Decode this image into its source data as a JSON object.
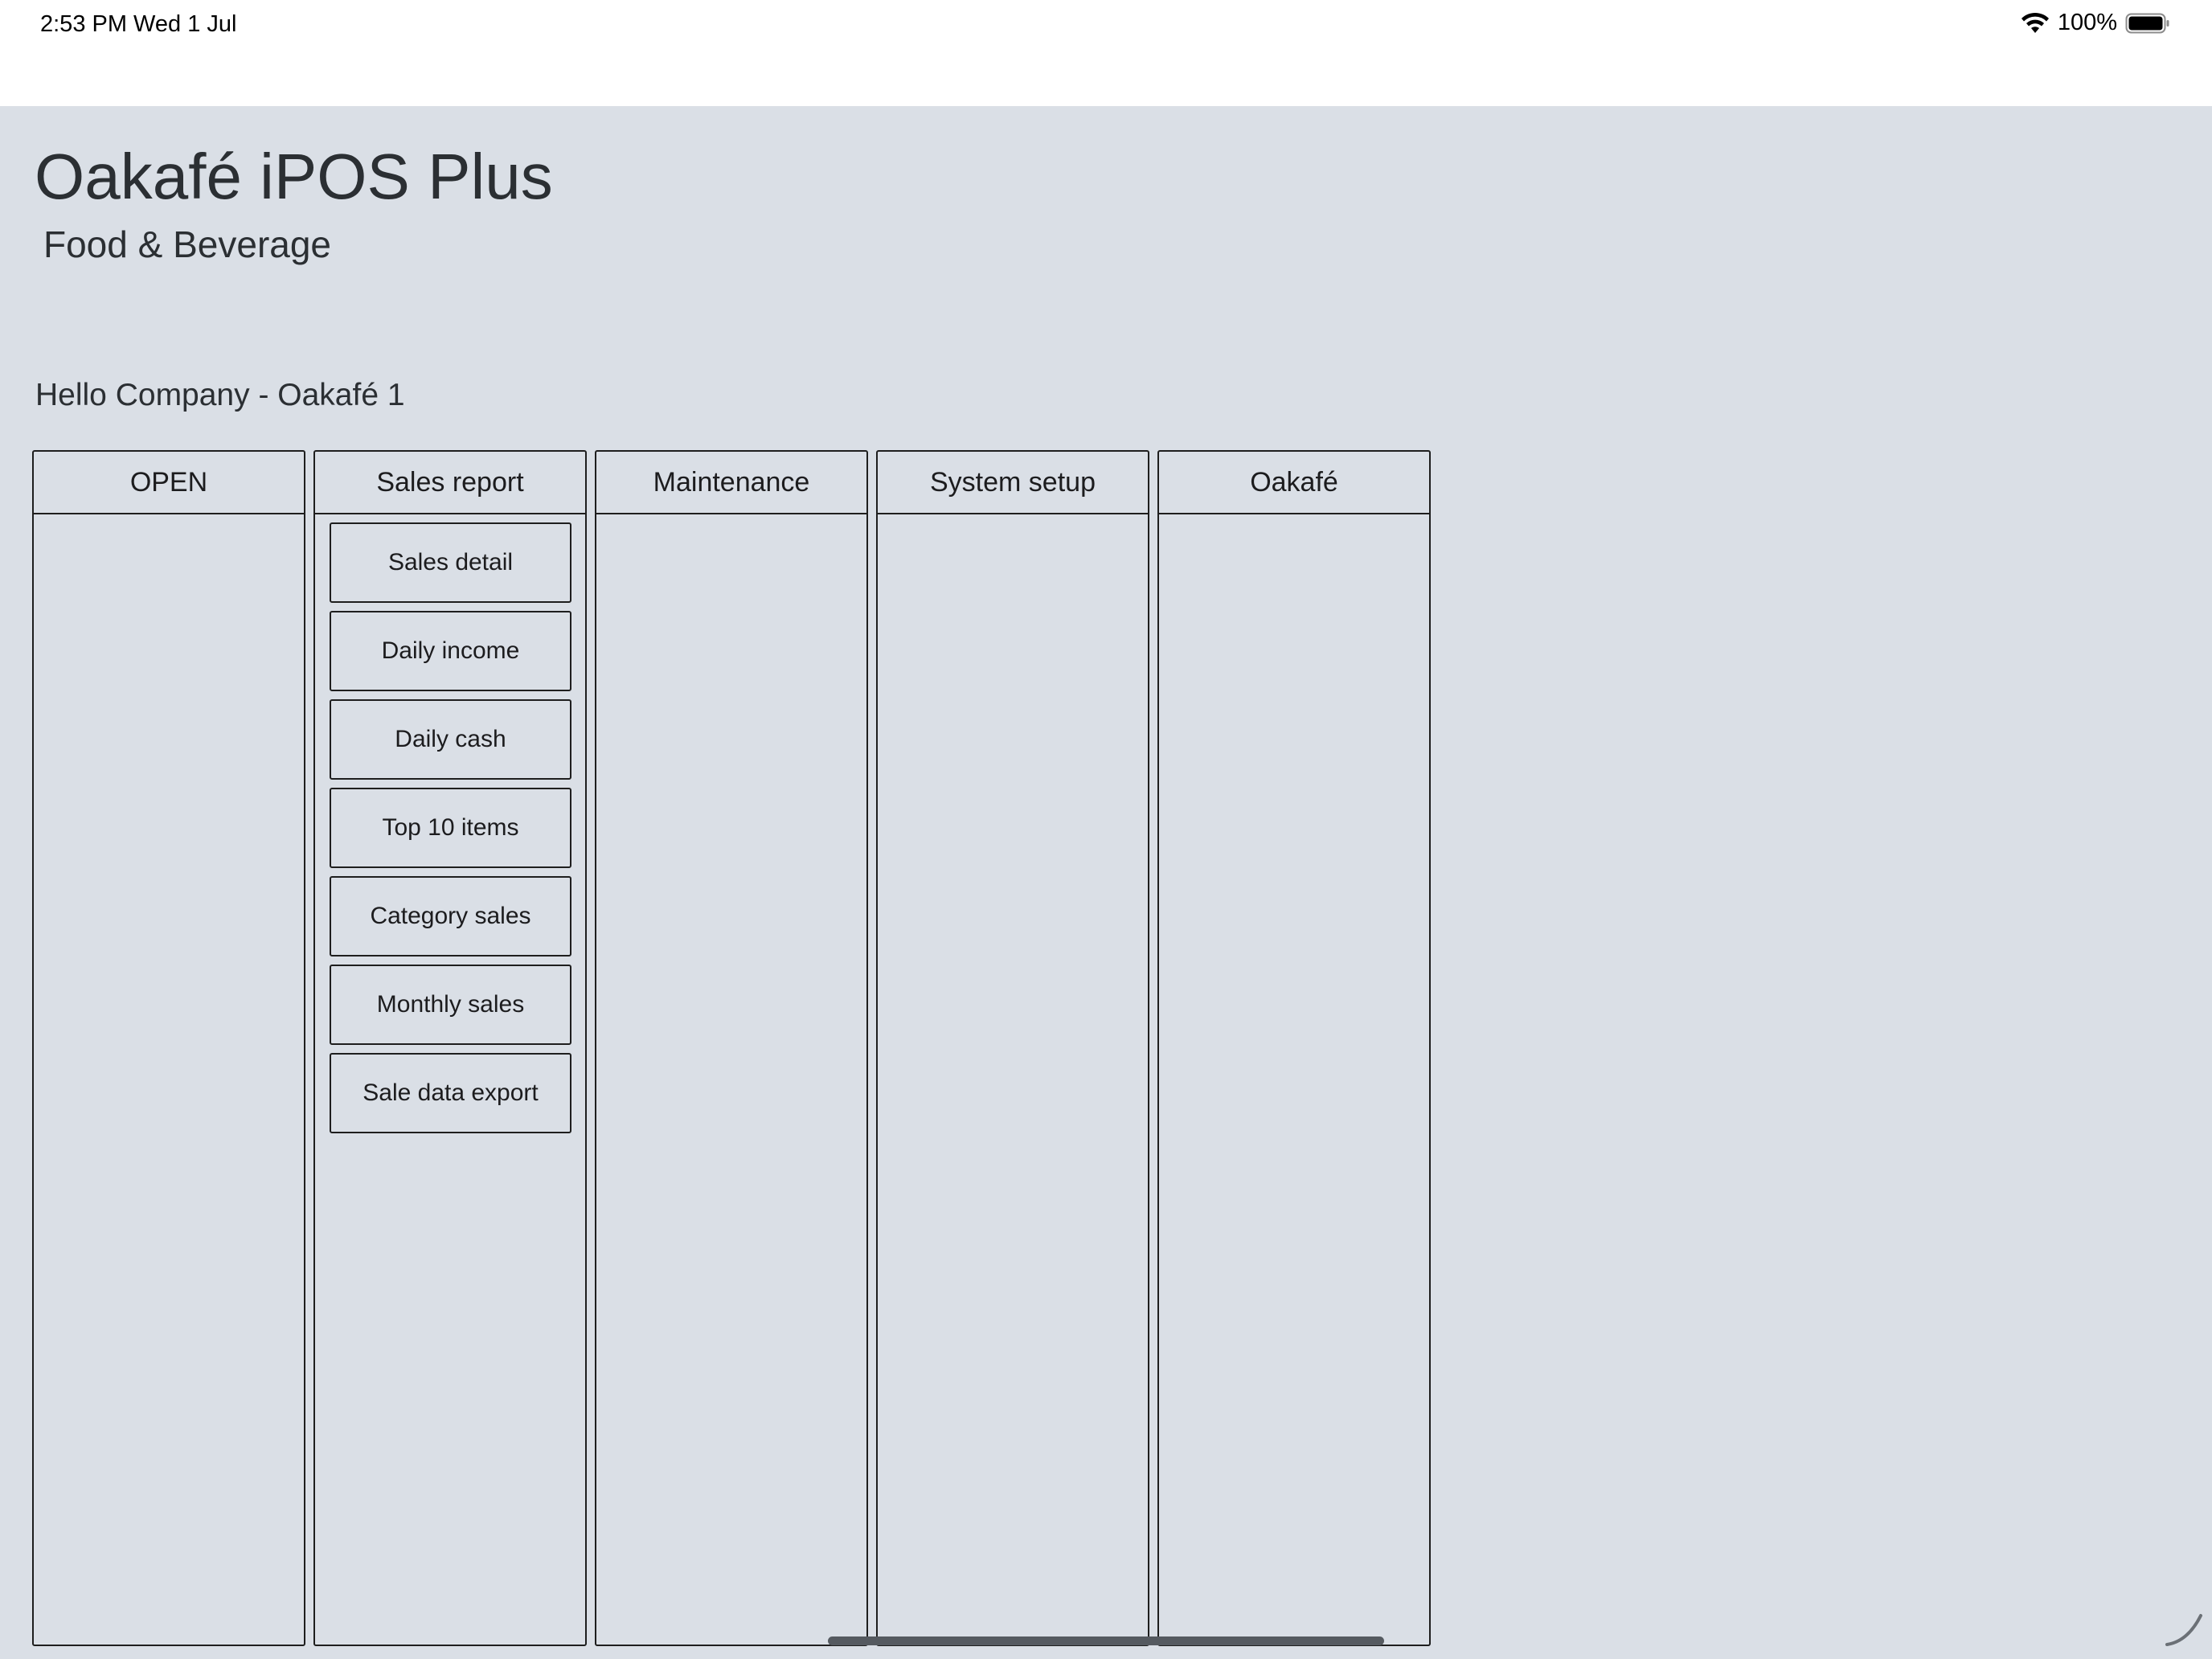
{
  "status_bar": {
    "time": "2:53 PM   Wed 1 Jul",
    "battery": "100%",
    "icons": [
      "wifi-icon",
      "battery-icon"
    ]
  },
  "header": {
    "title": "Oakafé iPOS Plus",
    "subtitle": "Food & Beverage"
  },
  "company_label": "Hello Company - Oakafé 1",
  "columns": [
    {
      "title": "OPEN",
      "items": []
    },
    {
      "title": "Sales report",
      "items": [
        "Sales detail",
        "Daily income",
        "Daily cash",
        "Top 10 items",
        "Category sales",
        "Monthly sales",
        "Sale data export"
      ]
    },
    {
      "title": "Maintenance",
      "items": []
    },
    {
      "title": "System setup",
      "items": []
    },
    {
      "title": "Oakafé",
      "items": []
    }
  ],
  "colors": {
    "app_background": "#dadfe6",
    "border": "#1e1e1e",
    "text": "#2b2f33"
  }
}
